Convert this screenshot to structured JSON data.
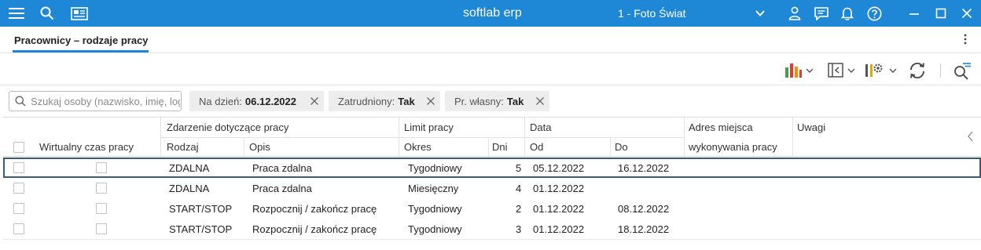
{
  "titlebar": {
    "app_title": "softlab erp",
    "company": "1 - Foto Świat"
  },
  "tab": {
    "label": "Pracownicy – rodzaje pracy"
  },
  "search": {
    "placeholder": "Szukaj osoby (nazwisko, imię, login)"
  },
  "filters": [
    {
      "label": "Na dzień:",
      "value": "06.12.2022"
    },
    {
      "label": "Zatrudniony:",
      "value": "Tak"
    },
    {
      "label": "Pr. własny:",
      "value": "Tak"
    }
  ],
  "grid": {
    "group_headers": {
      "zdarzenie": "Zdarzenie dotyczące pracy",
      "limit": "Limit pracy",
      "data": "Data",
      "adres_line1": "Adres miejsca",
      "uwagi": "Uwagi"
    },
    "columns": {
      "wirtualny": "Wirtualny czas pracy",
      "rodzaj": "Rodzaj",
      "opis": "Opis",
      "okres": "Okres",
      "dni": "Dni",
      "od": "Od",
      "do": "Do",
      "adres_line2": "wykonywania pracy"
    },
    "rows": [
      {
        "rodzaj": "ZDALNA",
        "opis": "Praca zdalna",
        "okres": "Tygodniowy",
        "dni": "5",
        "od": "05.12.2022",
        "do": "16.12.2022",
        "selected": true
      },
      {
        "rodzaj": "ZDALNA",
        "opis": "Praca zdalna",
        "okres": "Miesięczny",
        "dni": "4",
        "od": "01.12.2022",
        "do": "",
        "selected": false
      },
      {
        "rodzaj": "START/STOP",
        "opis": "Rozpocznij / zakończ pracę",
        "okres": "Tygodniowy",
        "dni": "2",
        "od": "01.12.2022",
        "do": "08.12.2022",
        "selected": false
      },
      {
        "rodzaj": "START/STOP",
        "opis": "Rozpocznij / zakończ pracę",
        "okres": "Tygodniowy",
        "dni": "3",
        "od": "01.12.2022",
        "do": "18.12.2022",
        "selected": false
      }
    ]
  },
  "icons": {
    "titlebar": [
      "menu-icon",
      "search-icon",
      "news-icon",
      "chevron-down-icon",
      "user-icon",
      "chat-icon",
      "bell-icon",
      "help-icon",
      "minimize-icon",
      "maximize-icon",
      "close-icon"
    ],
    "toolbar": [
      "chart-icon",
      "panel-toggle-icon",
      "settings-icon",
      "refresh-icon",
      "advanced-search-icon"
    ]
  },
  "colors": {
    "accent": "#1e88d6",
    "chart_red": "#e53935",
    "chart_green": "#43a047",
    "chart_orange": "#fb8c00"
  }
}
